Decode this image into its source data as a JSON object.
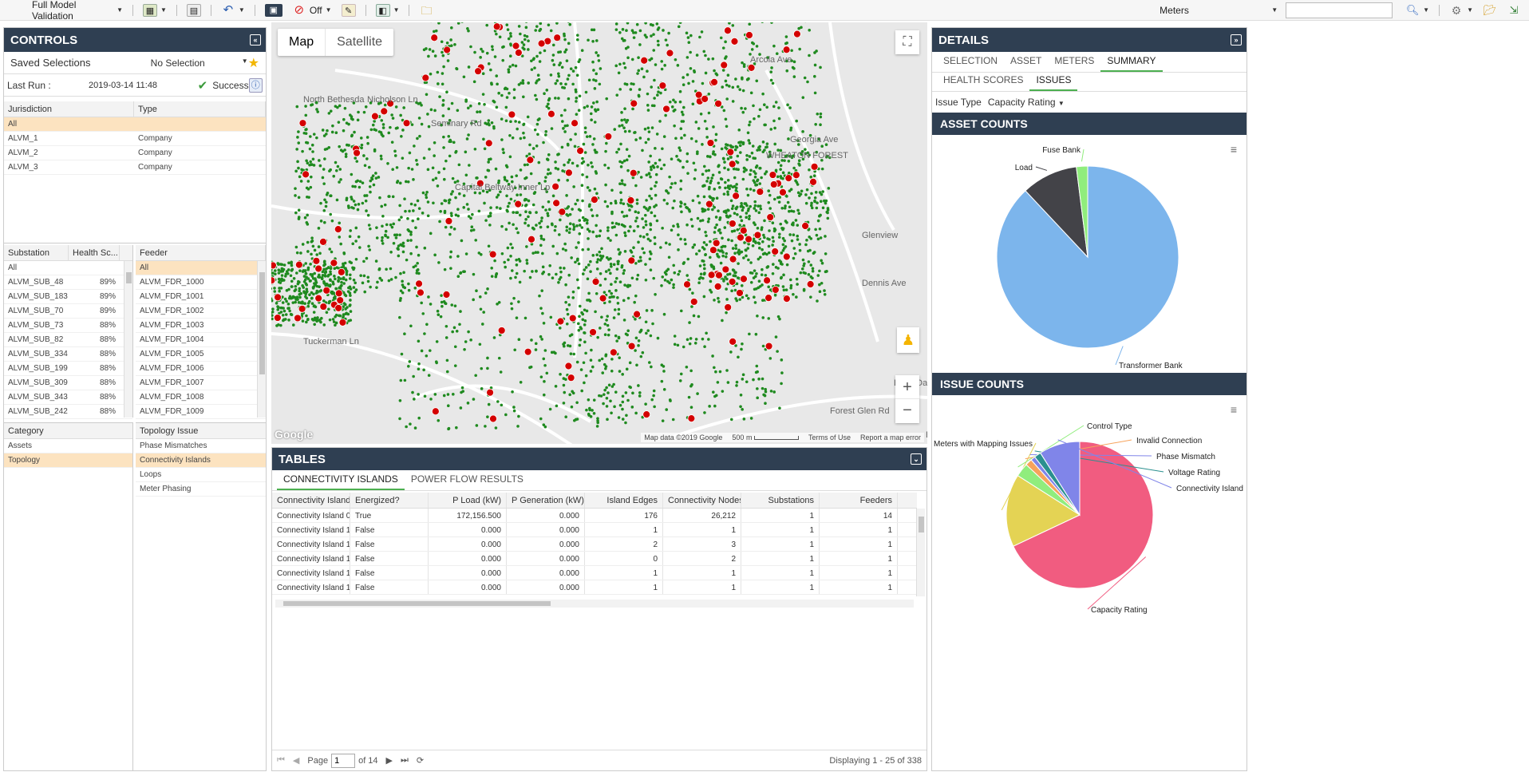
{
  "toolbar": {
    "model": "Full Model Validation",
    "off_label": "Off",
    "meters": "Meters",
    "search_placeholder": ""
  },
  "controls": {
    "title": "CONTROLS",
    "saved_label": "Saved Selections",
    "saved_value": "No Selection",
    "last_run_label": "Last Run :",
    "last_run_value": "2019-03-14 11:48",
    "status": "Success"
  },
  "jurisdiction": {
    "headers": [
      "Jurisdiction",
      "Type"
    ],
    "rows": [
      [
        "All",
        ""
      ],
      [
        "ALVM_1",
        "Company"
      ],
      [
        "ALVM_2",
        "Company"
      ],
      [
        "ALVM_3",
        "Company"
      ]
    ]
  },
  "substation": {
    "headers": [
      "Substation",
      "Health Sc..."
    ],
    "rows": [
      [
        "All",
        ""
      ],
      [
        "ALVM_SUB_48",
        "89%"
      ],
      [
        "ALVM_SUB_183",
        "89%"
      ],
      [
        "ALVM_SUB_70",
        "89%"
      ],
      [
        "ALVM_SUB_73",
        "88%"
      ],
      [
        "ALVM_SUB_82",
        "88%"
      ],
      [
        "ALVM_SUB_334",
        "88%"
      ],
      [
        "ALVM_SUB_199",
        "88%"
      ],
      [
        "ALVM_SUB_309",
        "88%"
      ],
      [
        "ALVM_SUB_343",
        "88%"
      ],
      [
        "ALVM_SUB_242",
        "88%"
      ]
    ]
  },
  "feeder": {
    "header": "Feeder",
    "rows": [
      "All",
      "ALVM_FDR_1000",
      "ALVM_FDR_1001",
      "ALVM_FDR_1002",
      "ALVM_FDR_1003",
      "ALVM_FDR_1004",
      "ALVM_FDR_1005",
      "ALVM_FDR_1006",
      "ALVM_FDR_1007",
      "ALVM_FDR_1008",
      "ALVM_FDR_1009"
    ]
  },
  "category": {
    "header": "Category",
    "rows": [
      "Assets",
      "Topology"
    ]
  },
  "topology": {
    "header": "Topology Issue",
    "rows": [
      "Phase Mismatches",
      "Connectivity Islands",
      "Loops",
      "Meter Phasing"
    ]
  },
  "map": {
    "tab_map": "Map",
    "tab_satellite": "Satellite",
    "labels": [
      "North Bethesda",
      "Nicholson Ln",
      "Arcola Ave",
      "WHEATON FOREST",
      "Glenview",
      "Dennis Ave",
      "Tuckerman Ln",
      "Lone Oak",
      "Forest Glen Rd",
      "Seminary Rd",
      "Capital Beltway Inner Lp",
      "Beach Dr",
      "Georgia Ave"
    ],
    "attribution": "Map data ©2019 Google",
    "scale": "500 m",
    "terms": "Terms of Use",
    "report": "Report a map error",
    "logo": "Google"
  },
  "tables": {
    "title": "TABLES",
    "tabs": [
      "CONNECTIVITY ISLANDS",
      "POWER FLOW RESULTS"
    ],
    "columns": [
      "Connectivity Island",
      "Energized?",
      "P Load (kW)",
      "P Generation (kW)",
      "Island Edges",
      "Connectivity Nodes",
      "Substations",
      "Feeders"
    ],
    "rows": [
      [
        "Connectivity Island 0",
        "True",
        "172,156.500",
        "0.000",
        "176",
        "26,212",
        "1",
        "14"
      ],
      [
        "Connectivity Island 103",
        "False",
        "0.000",
        "0.000",
        "1",
        "1",
        "1",
        "1"
      ],
      [
        "Connectivity Island 108",
        "False",
        "0.000",
        "0.000",
        "2",
        "3",
        "1",
        "1"
      ],
      [
        "Connectivity Island 151",
        "False",
        "0.000",
        "0.000",
        "0",
        "2",
        "1",
        "1"
      ],
      [
        "Connectivity Island 156",
        "False",
        "0.000",
        "0.000",
        "1",
        "1",
        "1",
        "1"
      ],
      [
        "Connectivity Island 158",
        "False",
        "0.000",
        "0.000",
        "1",
        "1",
        "1",
        "1"
      ]
    ],
    "page_label": "Page",
    "page_value": "1",
    "page_of": "of 14",
    "displaying": "Displaying 1 - 25 of 338"
  },
  "details": {
    "title": "DETAILS",
    "tabs": [
      "SELECTION",
      "ASSET",
      "METERS",
      "SUMMARY"
    ],
    "subtabs": [
      "HEALTH SCORES",
      "ISSUES"
    ],
    "issue_type_label": "Issue Type",
    "issue_type_value": "Capacity Rating",
    "asset_counts_title": "ASSET COUNTS",
    "issue_counts_title": "ISSUE COUNTS"
  },
  "chart_data": [
    {
      "type": "pie",
      "title": "ASSET COUNTS",
      "labels": [
        "Transformer Bank",
        "Load",
        "Fuse Bank"
      ],
      "values": [
        88,
        10,
        2
      ],
      "colors": [
        "#7cb5ec",
        "#434348",
        "#90ed7d"
      ]
    },
    {
      "type": "pie",
      "title": "ISSUE COUNTS",
      "labels": [
        "Capacity Rating",
        "Meters with Mapping Issues",
        "Control Type",
        "Invalid Connection",
        "Phase Mismatch",
        "Voltage Rating",
        "Connectivity Island"
      ],
      "values": [
        68,
        16,
        3,
        1.5,
        1,
        1.5,
        9
      ],
      "colors": [
        "#f15c80",
        "#e4d354",
        "#90ed7d",
        "#f7a35c",
        "#8085e9",
        "#2b908f",
        "#8085e9"
      ]
    }
  ]
}
